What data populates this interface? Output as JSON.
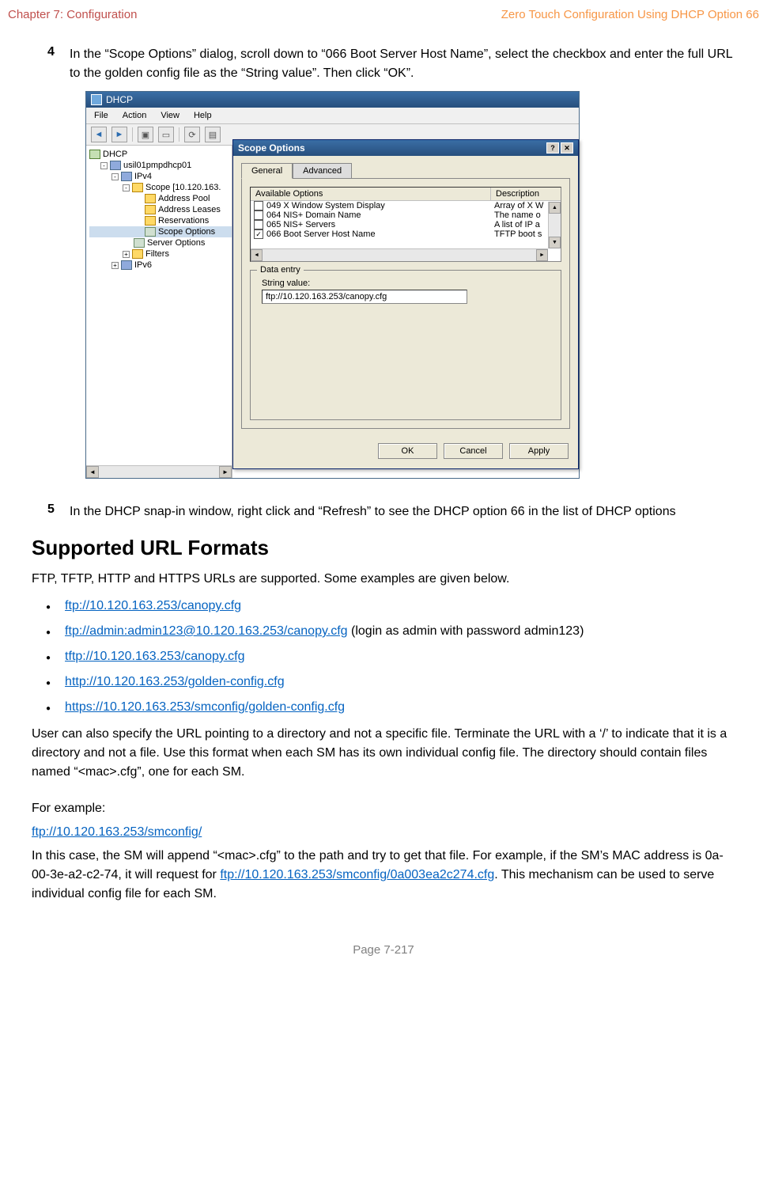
{
  "header": {
    "left": "Chapter 7:  Configuration",
    "right": "Zero Touch Configuration Using DHCP Option 66"
  },
  "step4": {
    "num": "4",
    "text": "In the “Scope Options” dialog, scroll down to “066 Boot Server Host Name”, select the checkbox and enter the full URL to the golden config file as the “String value”. Then click “OK”."
  },
  "dhcp_window": {
    "title": "DHCP",
    "menus": {
      "file": "File",
      "action": "Action",
      "view": "View",
      "help": "Help"
    },
    "tree": {
      "root": "DHCP",
      "server": "usil01pmpdhcp01",
      "ipv4": "IPv4",
      "scope": "Scope [10.120.163.",
      "items": {
        "pool": "Address Pool",
        "leases": "Address Leases",
        "reservations": "Reservations",
        "scope_options": "Scope Options",
        "server_options": "Server Options",
        "filters": "Filters"
      },
      "ipv6": "IPv6"
    }
  },
  "scope_dialog": {
    "title": "Scope Options",
    "tabs": {
      "general": "General",
      "advanced": "Advanced"
    },
    "columns": {
      "available": "Available Options",
      "description": "Description"
    },
    "options": {
      "opt049": {
        "label": "049 X Window System Display",
        "desc": "Array of X W"
      },
      "opt064": {
        "label": "064 NIS+ Domain Name",
        "desc": "The name o"
      },
      "opt065": {
        "label": "065 NIS+ Servers",
        "desc": "A list of IP a"
      },
      "opt066": {
        "label": "066 Boot Server Host Name",
        "desc": "TFTP boot s"
      }
    },
    "fieldset": "Data entry",
    "string_label": "String value:",
    "string_value": "ftp://10.120.163.253/canopy.cfg",
    "buttons": {
      "ok": "OK",
      "cancel": "Cancel",
      "apply": "Apply"
    }
  },
  "step5": {
    "num": "5",
    "text": "In the DHCP snap-in window, right click and “Refresh” to see the DHCP option 66 in the list of DHCP options"
  },
  "heading": "Supported URL Formats",
  "intro": "FTP, TFTP, HTTP and HTTPS URLs are supported. Some examples are given below.",
  "urls": {
    "u1": "ftp://10.120.163.253/canopy.cfg",
    "u2": "ftp://admin:admin123@10.120.163.253/canopy.cfg",
    "u2_suffix": "  (login as admin with password admin123)",
    "u3": "tftp://10.120.163.253/canopy.cfg",
    "u4": "http://10.120.163.253/golden-config.cfg",
    "u5": "https://10.120.163.253/smconfig/golden-config.cfg"
  },
  "para_after": "User can also specify the URL pointing to a directory and not a specific file. Terminate the URL with a ‘/’ to indicate that it is a directory and not a file. Use this format when each SM has its own individual config file. The directory should contain files named “<mac>.cfg”, one for each SM.",
  "example_label": "For example:",
  "example_url": "ftp://10.120.163.253/smconfig/",
  "final_p1": "In this case, the SM will append “<mac>.cfg” to the path and try to get that file. For example, if the SM’s MAC address is 0a-00-3e-a2-c2-74, it will request for ",
  "final_link": "ftp://10.120.163.253/smconfig/0a003ea2c274.cfg",
  "final_p2": ". This mechanism can be used to serve individual config file for each SM.",
  "footer": "Page 7-217"
}
